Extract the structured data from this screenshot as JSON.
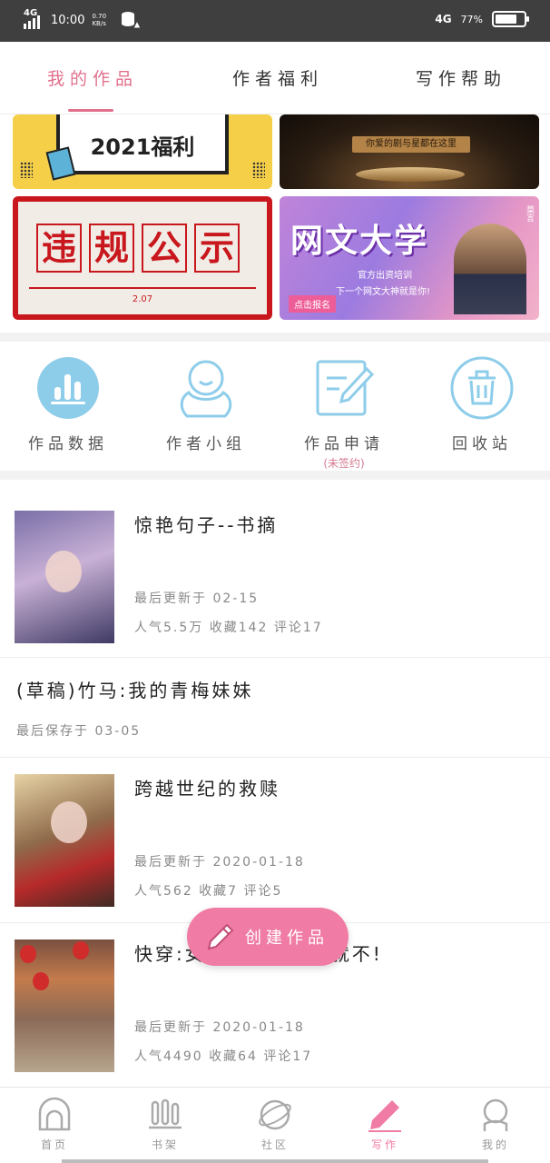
{
  "status_bar": {
    "network_left": "4G",
    "time": "10:00",
    "speed_value": "0.70",
    "speed_unit": "KB/s",
    "network_right": "4G",
    "battery": "77%",
    "battery_level": 0.77
  },
  "tabs": [
    {
      "label": "我的作品",
      "active": true
    },
    {
      "label": "作者福利",
      "active": false
    },
    {
      "label": "写作帮助",
      "active": false
    }
  ],
  "banners": {
    "welfare": {
      "text": "2021福利"
    },
    "drama": {
      "text": "你爱的剧与星都在这里"
    },
    "violation": {
      "chars": [
        "违",
        "规",
        "公",
        "示"
      ],
      "date": "2.07"
    },
    "university": {
      "title": "网文大学",
      "subtitle": "下一个网文大神就是你!",
      "tag": "官方出资培训",
      "signup": "点击报名",
      "side_tag": "莫言"
    }
  },
  "tools": [
    {
      "label": "作品数据",
      "icon": "bar-chart-icon"
    },
    {
      "label": "作者小组",
      "icon": "group-icon"
    },
    {
      "label": "作品申请",
      "note": "(未签约)",
      "icon": "edit-icon"
    },
    {
      "label": "回收站",
      "icon": "trash-icon"
    }
  ],
  "works": [
    {
      "title": "惊艳句子--书摘",
      "update": "最后更新于 02-15",
      "stats": "人气5.5万 收藏142 评论17"
    },
    {
      "title": "(草稿)竹马:我的青梅妹妹",
      "update": "最后保存于 03-05"
    },
    {
      "title": "跨越世纪的救赎",
      "update": "最后更新于 2020-01-18",
      "stats": "人气562 收藏7 评论5"
    },
    {
      "title": "快穿:女主之女主说我就不!",
      "update": "最后更新于 2020-01-18",
      "stats": "人气4490 收藏64 评论17"
    }
  ],
  "fab": {
    "label": "创建作品"
  },
  "bottom_nav": [
    {
      "label": "首页",
      "icon": "home-icon"
    },
    {
      "label": "书架",
      "icon": "bookshelf-icon"
    },
    {
      "label": "社区",
      "icon": "planet-icon"
    },
    {
      "label": "写作",
      "icon": "pen-icon",
      "active": true
    },
    {
      "label": "我的",
      "icon": "profile-icon"
    }
  ],
  "colors": {
    "accent": "#f07ba4",
    "tab_active": "#e0708c",
    "icon_blue": "#8ecdea"
  }
}
